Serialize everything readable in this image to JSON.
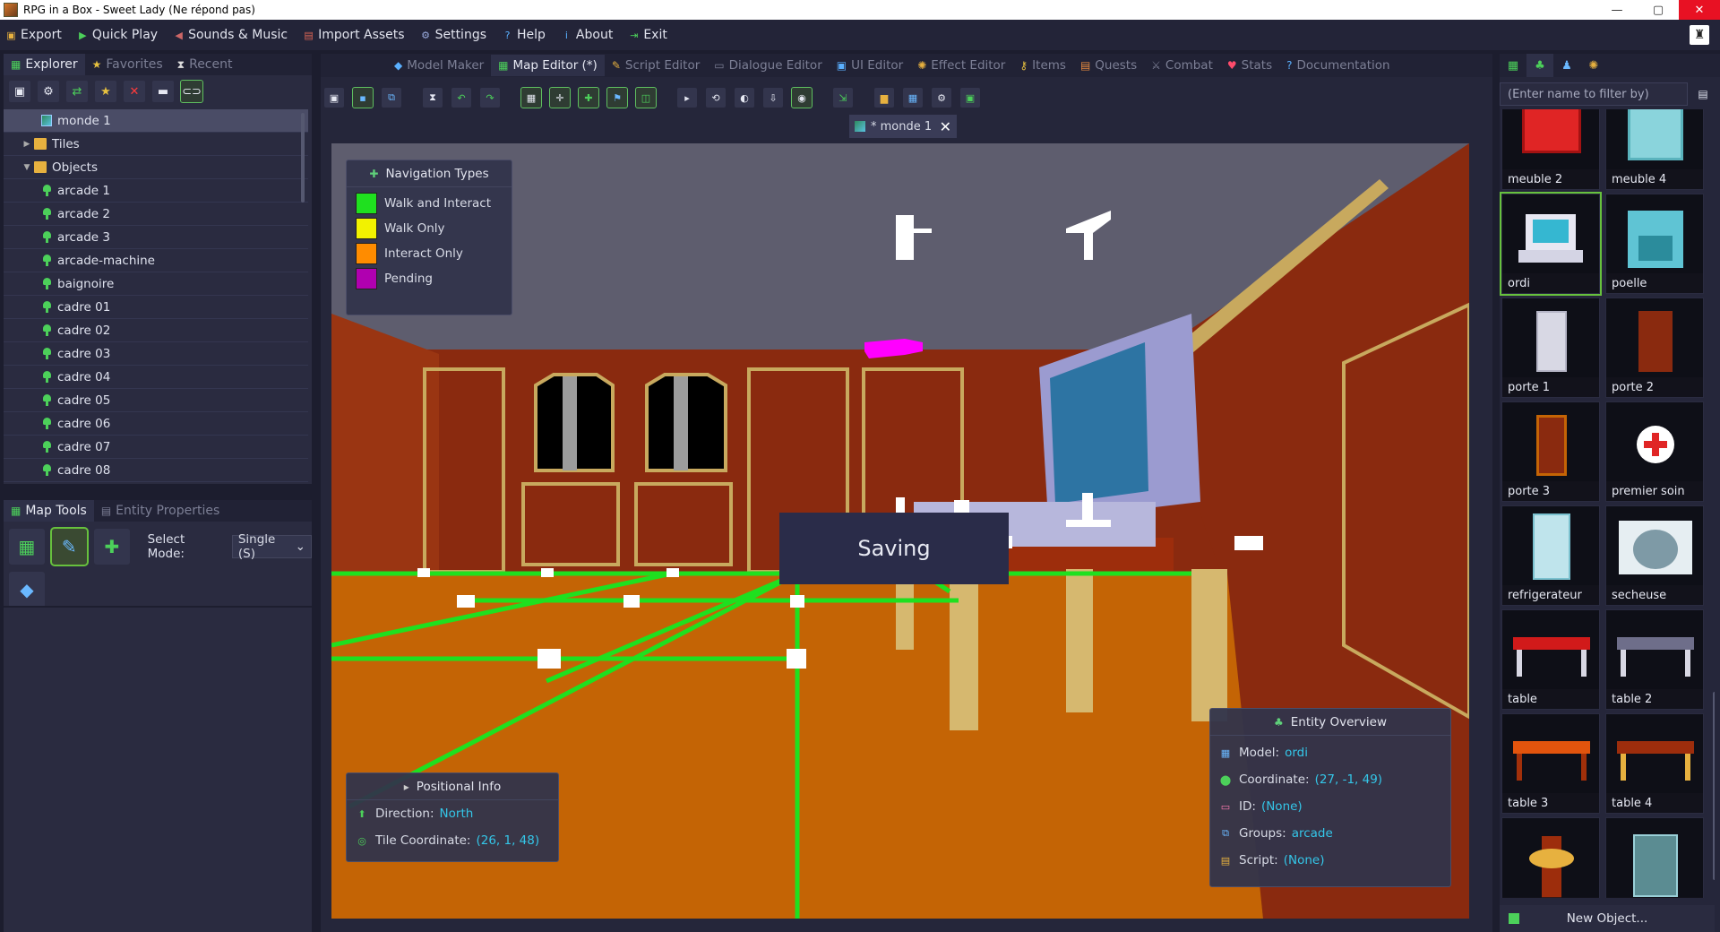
{
  "window": {
    "title": "RPG in a Box - Sweet Lady (Ne répond pas)",
    "minimize": "—",
    "maximize": "▢",
    "close": "✕"
  },
  "menubar": [
    {
      "label": "Export",
      "icon": "export-icon"
    },
    {
      "label": "Quick Play",
      "icon": "play-icon"
    },
    {
      "label": "Sounds & Music",
      "icon": "speaker-icon"
    },
    {
      "label": "Import Assets",
      "icon": "import-icon"
    },
    {
      "label": "Settings",
      "icon": "gear-icon"
    },
    {
      "label": "Help",
      "icon": "help-icon"
    },
    {
      "label": "About",
      "icon": "info-icon"
    },
    {
      "label": "Exit",
      "icon": "exit-icon"
    }
  ],
  "explorer": {
    "tabs": [
      {
        "label": "Explorer",
        "active": true
      },
      {
        "label": "Favorites",
        "active": false
      },
      {
        "label": "Recent",
        "active": false
      }
    ],
    "tree": {
      "map": "monde 1",
      "tiles": "Tiles",
      "objects": "Objects",
      "items": [
        "arcade 1",
        "arcade 2",
        "arcade 3",
        "arcade-machine",
        "baignoire",
        "cadre 01",
        "cadre 02",
        "cadre 03",
        "cadre 04",
        "cadre 05",
        "cadre 06",
        "cadre 07",
        "cadre 08"
      ]
    }
  },
  "maptools": {
    "tabs": [
      {
        "label": "Map Tools",
        "active": true
      },
      {
        "label": "Entity Properties",
        "active": false
      }
    ],
    "select_mode_label": "Select Mode:",
    "select_mode_value": "Single (S)"
  },
  "editor_tabs": [
    {
      "label": "Model Maker",
      "active": false
    },
    {
      "label": "Map Editor (*)",
      "active": true
    },
    {
      "label": "Script Editor",
      "active": false
    },
    {
      "label": "Dialogue Editor",
      "active": false
    },
    {
      "label": "UI Editor",
      "active": false
    },
    {
      "label": "Effect Editor",
      "active": false
    },
    {
      "label": "Items",
      "active": false
    },
    {
      "label": "Quests",
      "active": false
    },
    {
      "label": "Combat",
      "active": false
    },
    {
      "label": "Stats",
      "active": false
    },
    {
      "label": "Documentation",
      "active": false
    }
  ],
  "document_tab": "* monde 1",
  "navigation_types": {
    "title": "Navigation Types",
    "items": [
      {
        "label": "Walk and Interact",
        "color": "#1fe01f"
      },
      {
        "label": "Walk Only",
        "color": "#f2f200"
      },
      {
        "label": "Interact Only",
        "color": "#ff8c00"
      },
      {
        "label": "Pending",
        "color": "#b000b0"
      }
    ]
  },
  "saving": "Saving",
  "positional_info": {
    "title": "Positional Info",
    "direction_label": "Direction:",
    "direction_value": "North",
    "tile_label": "Tile Coordinate:",
    "tile_value": "(26, 1, 48)"
  },
  "entity_overview": {
    "title": "Entity Overview",
    "model_label": "Model:",
    "model_value": "ordi",
    "coord_label": "Coordinate:",
    "coord_value": "(27, -1, 49)",
    "id_label": "ID:",
    "id_value": "(None)",
    "groups_label": "Groups:",
    "groups_value": "arcade",
    "script_label": "Script:",
    "script_value": "(None)"
  },
  "assets_panel": {
    "filter_placeholder": "(Enter name to filter by)",
    "items": [
      "meuble 2",
      "meuble 4",
      "ordi",
      "poelle",
      "porte 1",
      "porte 2",
      "porte 3",
      "premier soin",
      "refrigerateur",
      "secheuse",
      "table",
      "table 2",
      "table 3",
      "table 4",
      "",
      ""
    ],
    "selected": "ordi",
    "new_object": "New Object..."
  }
}
